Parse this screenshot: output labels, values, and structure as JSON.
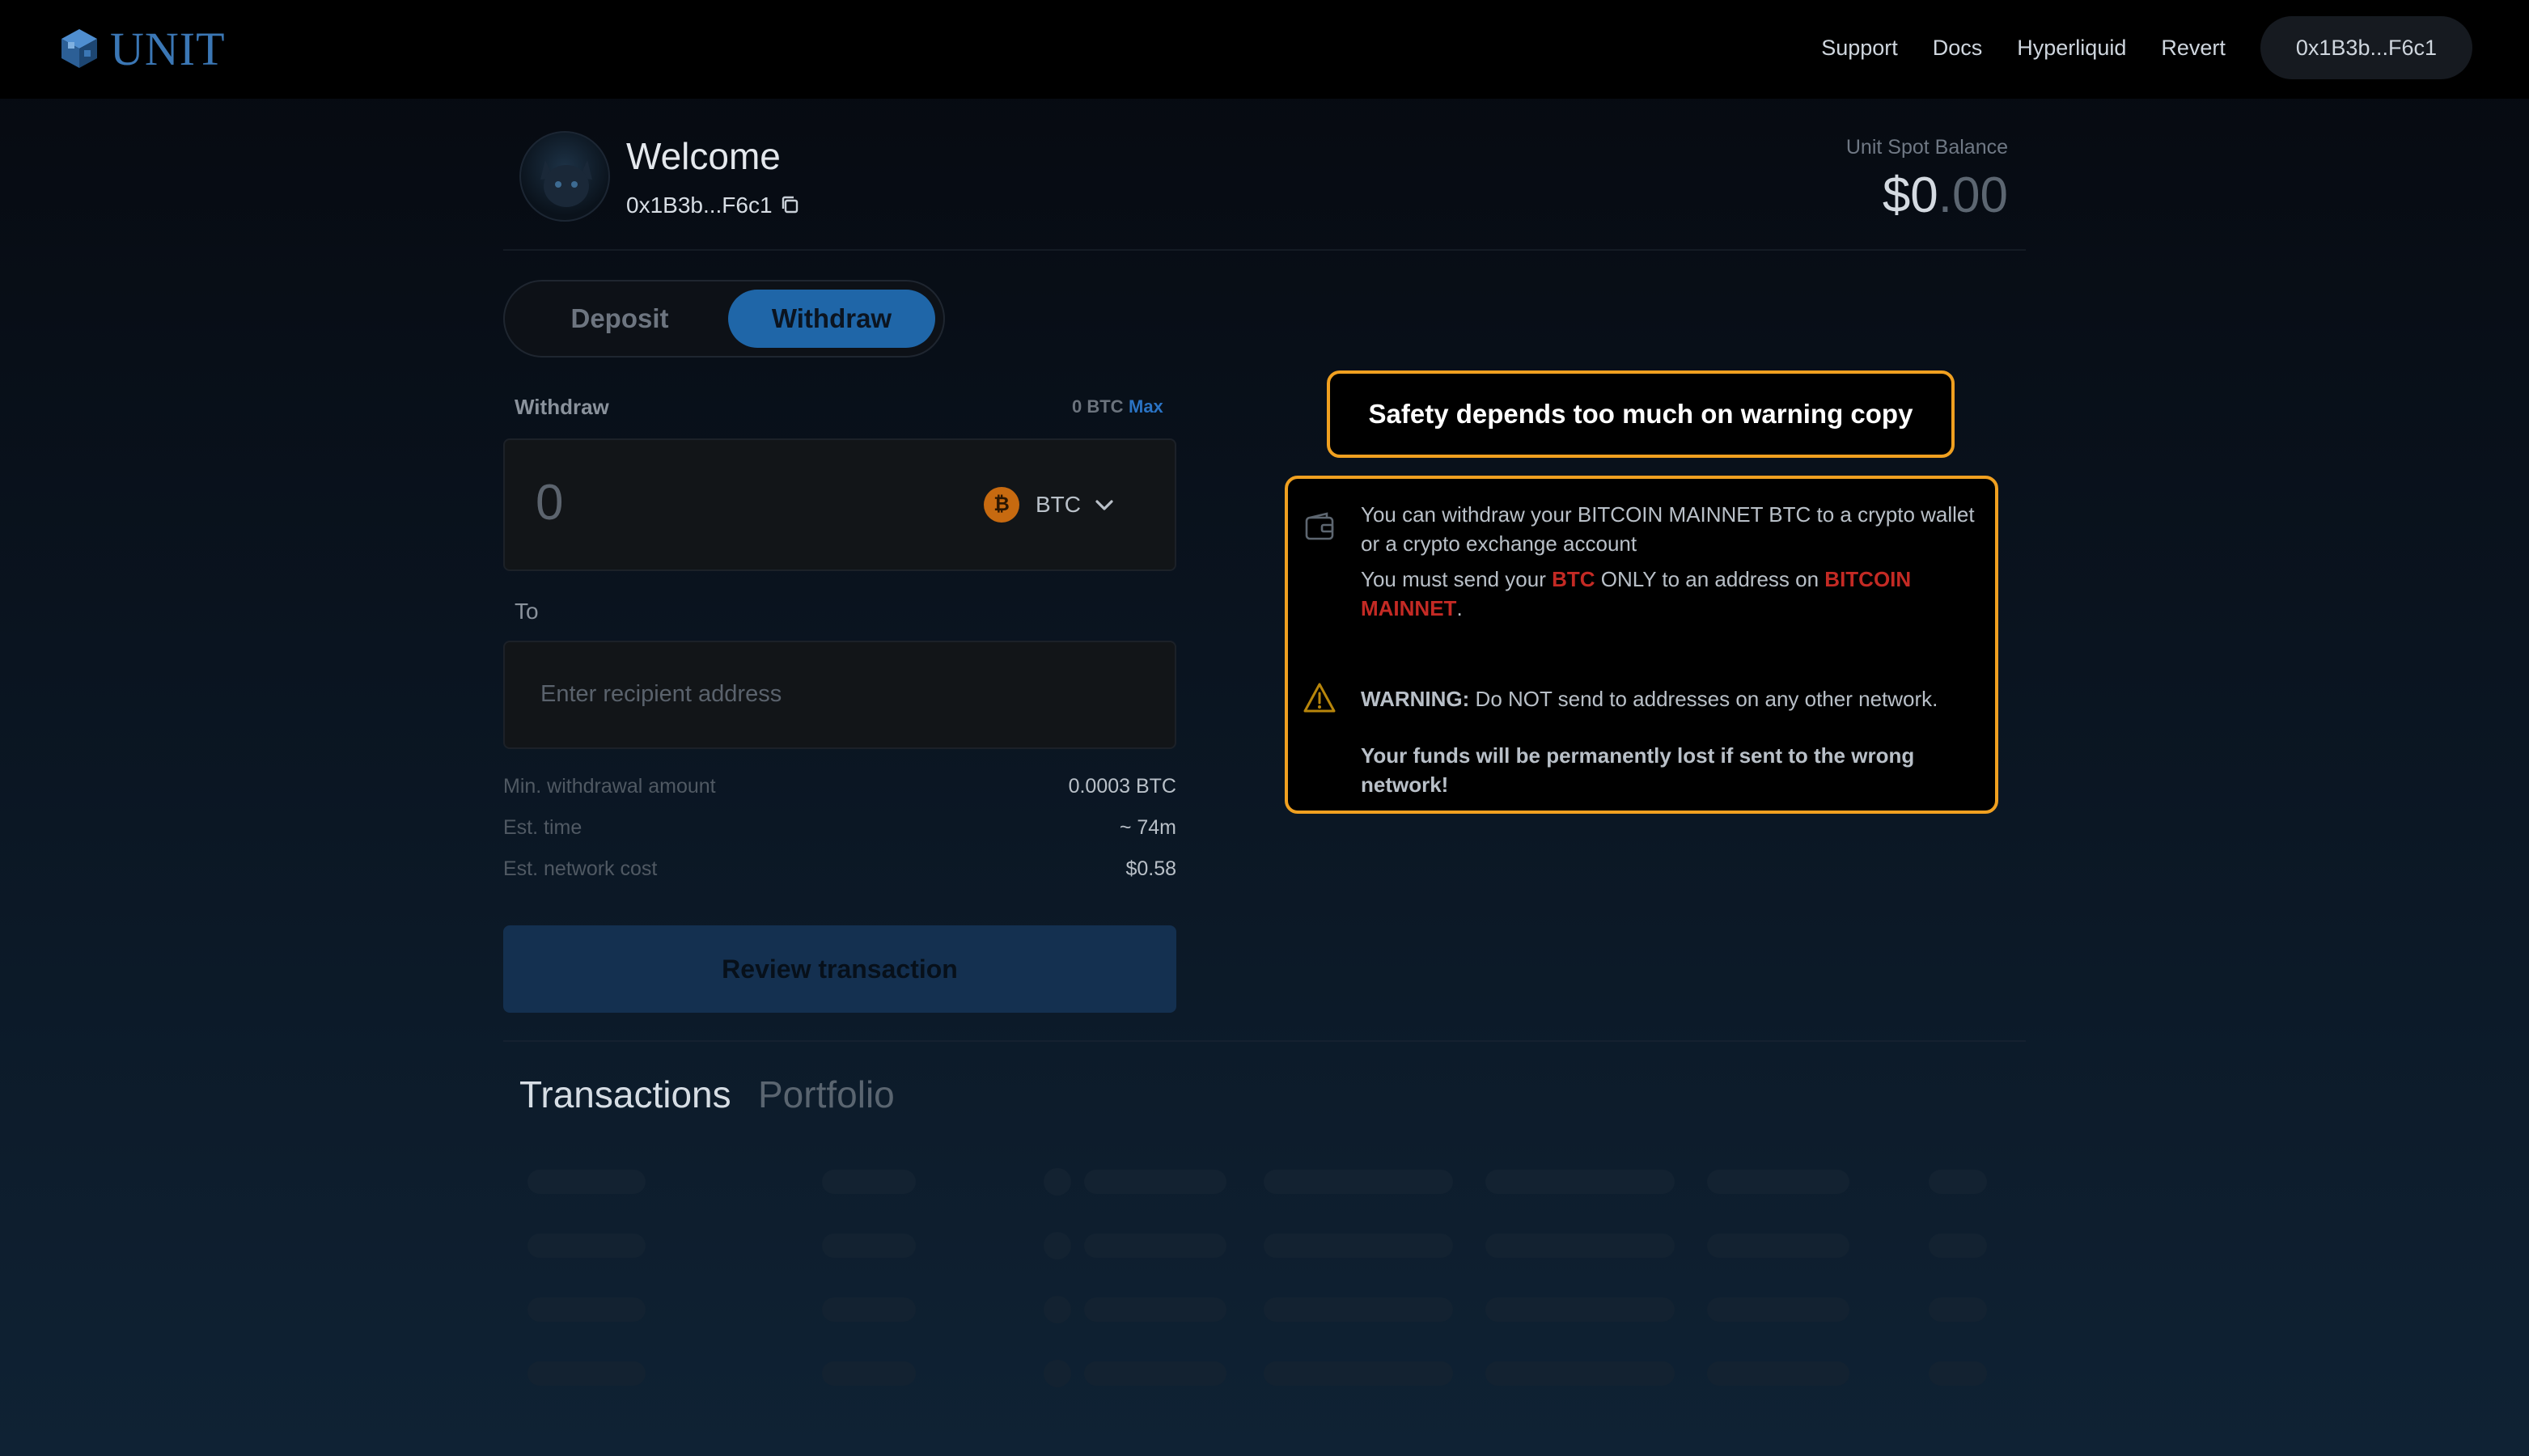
{
  "app": {
    "logo_text": "UNIT"
  },
  "nav": {
    "links": [
      "Support",
      "Docs",
      "Hyperliquid",
      "Revert"
    ],
    "wallet_label": "0x1B3b...F6c1"
  },
  "header": {
    "welcome": "Welcome",
    "address": "0x1B3b...F6c1",
    "balance_label": "Unit Spot Balance",
    "balance_int": "$0",
    "balance_dec": ".00"
  },
  "toggle": {
    "deposit": "Deposit",
    "withdraw": "Withdraw",
    "active": "withdraw"
  },
  "form": {
    "withdraw_label": "Withdraw",
    "available": "0 BTC",
    "max_label": "Max",
    "amount_value": "0",
    "asset": "BTC",
    "asset_symbol": "₿",
    "to_label": "To",
    "recipient_placeholder": "Enter recipient address",
    "info": [
      {
        "key": "Min. withdrawal amount",
        "value": "0.0003 BTC"
      },
      {
        "key": "Est. time",
        "value": "~ 74m"
      },
      {
        "key": "Est. network cost",
        "value": "$0.58"
      }
    ],
    "review_button": "Review transaction"
  },
  "callout": {
    "text": "Safety depends too much on warning copy"
  },
  "notice": {
    "line1": "You can withdraw your BITCOIN MAINNET BTC to a crypto wallet or a crypto exchange account",
    "line2_prefix": "You must send your ",
    "line2_btc": "BTC",
    "line2_only": " ONLY",
    "line2_mid": " to an address on ",
    "line2_network": "BITCOIN MAINNET",
    "line2_end": ".",
    "warning_label": "WARNING:",
    "warning_text": " Do NOT send to addresses on any other network.",
    "loss_text": "Your funds will be permanently lost if sent to the wrong network!"
  },
  "bottom_tabs": {
    "transactions": "Transactions",
    "portfolio": "Portfolio",
    "active": "transactions"
  },
  "colors": {
    "accent": "#1f66a8",
    "warning_border": "#f0a020",
    "danger": "#c42a24",
    "btc": "#c76a10"
  },
  "icons": [
    "unit-logo-icon",
    "copy-icon",
    "btc-icon",
    "chevron-down-icon",
    "wallet-icon",
    "warning-triangle-icon"
  ]
}
